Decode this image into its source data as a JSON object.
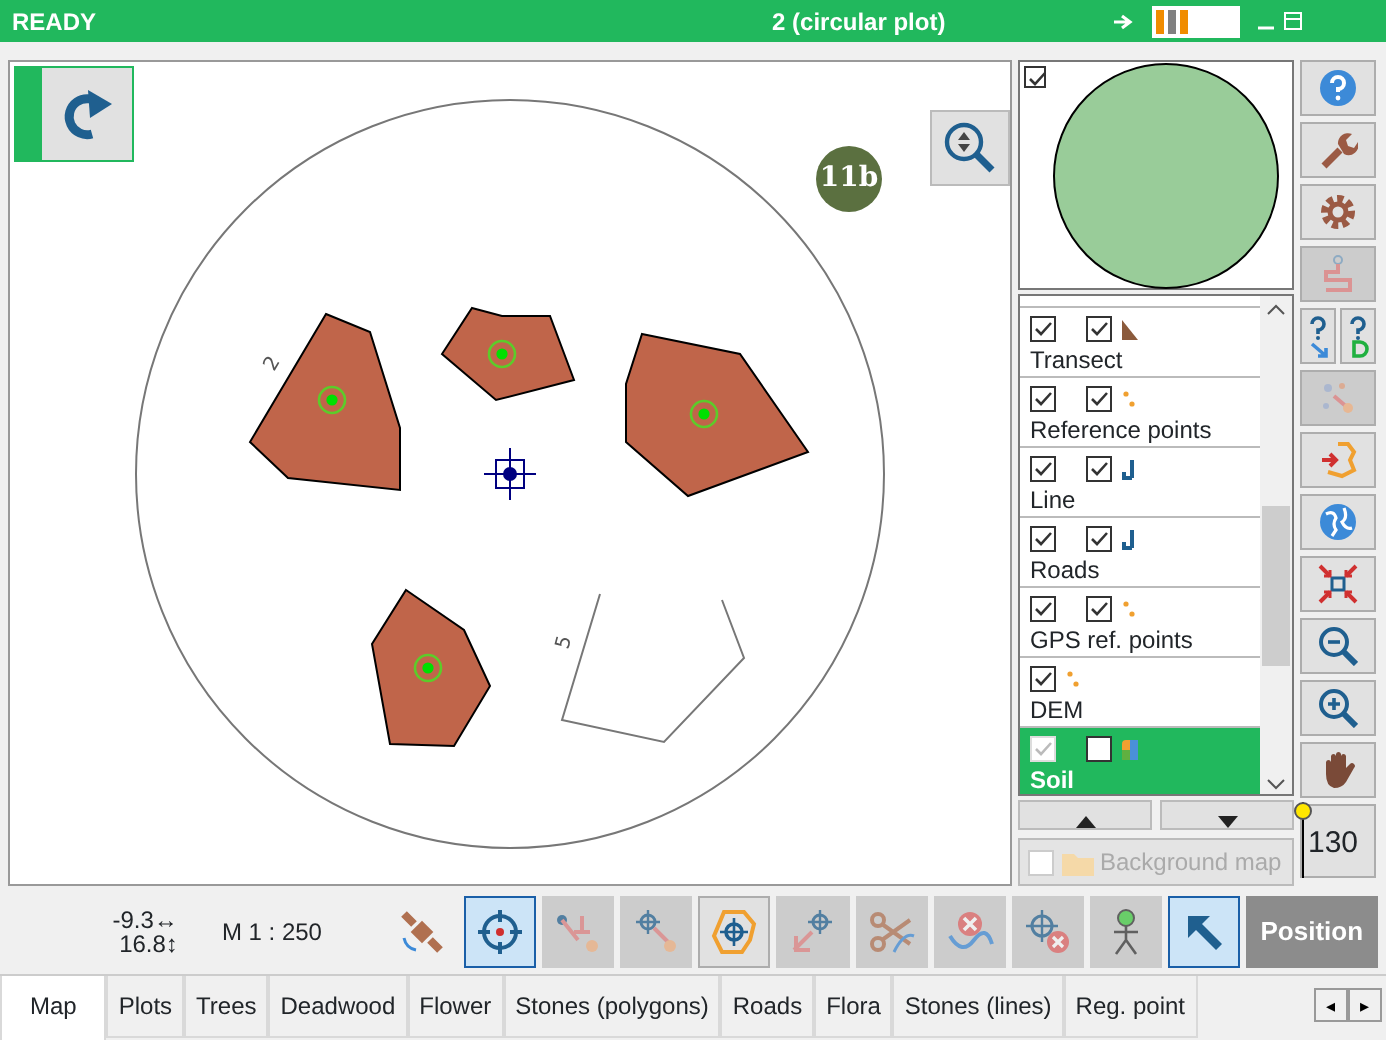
{
  "title_bar": {
    "status": "READY",
    "plot": "2 (circular plot)"
  },
  "map": {
    "badge": "11b",
    "plot_labels": [
      "2",
      "5"
    ]
  },
  "preview": {
    "checked": true
  },
  "layers": [
    {
      "name": "Transect",
      "kind": "polygon",
      "visible": true,
      "selectable": true,
      "selected": false
    },
    {
      "name": "Reference points",
      "kind": "points",
      "visible": true,
      "selectable": true,
      "selected": false
    },
    {
      "name": "Line",
      "kind": "line",
      "visible": true,
      "selectable": true,
      "selected": false
    },
    {
      "name": "Roads",
      "kind": "line",
      "visible": true,
      "selectable": true,
      "selected": false
    },
    {
      "name": "GPS ref. points",
      "kind": "points",
      "visible": true,
      "selectable": true,
      "selected": false
    },
    {
      "name": "DEM",
      "kind": "points",
      "visible": true,
      "selected": false
    },
    {
      "name": "Soil",
      "kind": "raster",
      "visible": true,
      "selectable": false,
      "selected": true
    }
  ],
  "background_map": {
    "label": "Background map",
    "checked": false,
    "disabled": true
  },
  "right_tools": [
    {
      "disabled": false
    },
    {
      "disabled": false
    },
    {
      "disabled": false
    },
    {
      "disabled": true
    },
    {
      "disabled": false
    },
    {
      "disabled": false
    },
    {
      "disabled": true
    },
    {
      "disabled": false
    },
    {
      "disabled": false
    },
    {
      "disabled": false
    },
    {
      "disabled": false
    },
    {
      "disabled": false
    },
    {
      "disabled": false
    }
  ],
  "zoom_slider": {
    "value": "130",
    "level": 1
  },
  "coordinates": {
    "x": "-9.3↔",
    "y": "16.8↕"
  },
  "scale": "M 1 : 250",
  "bottom_tools": [
    {
      "active": false,
      "disabled": false
    },
    {
      "active": true,
      "disabled": false
    },
    {
      "active": false,
      "disabled": true
    },
    {
      "active": false,
      "disabled": true
    },
    {
      "active": false,
      "disabled": false
    },
    {
      "active": false,
      "disabled": true
    },
    {
      "active": false,
      "disabled": true
    },
    {
      "active": false,
      "disabled": true
    },
    {
      "active": false,
      "disabled": true
    },
    {
      "active": false,
      "disabled": true
    },
    {
      "active": true,
      "disabled": false
    }
  ],
  "position_button": "Position",
  "tabs": [
    {
      "label": "Map",
      "selected": true
    },
    {
      "label": "Plots",
      "selected": false
    },
    {
      "label": "Trees",
      "selected": false
    },
    {
      "label": "Deadwood",
      "selected": false
    },
    {
      "label": "Flower",
      "selected": false
    },
    {
      "label": "Stones (polygons)",
      "selected": false
    },
    {
      "label": "Roads",
      "selected": false
    },
    {
      "label": "Flora",
      "selected": false
    },
    {
      "label": "Stones (lines)",
      "selected": false
    },
    {
      "label": "Reg. point",
      "selected": false
    }
  ],
  "tab_scroll": [
    "◂",
    "▸"
  ]
}
